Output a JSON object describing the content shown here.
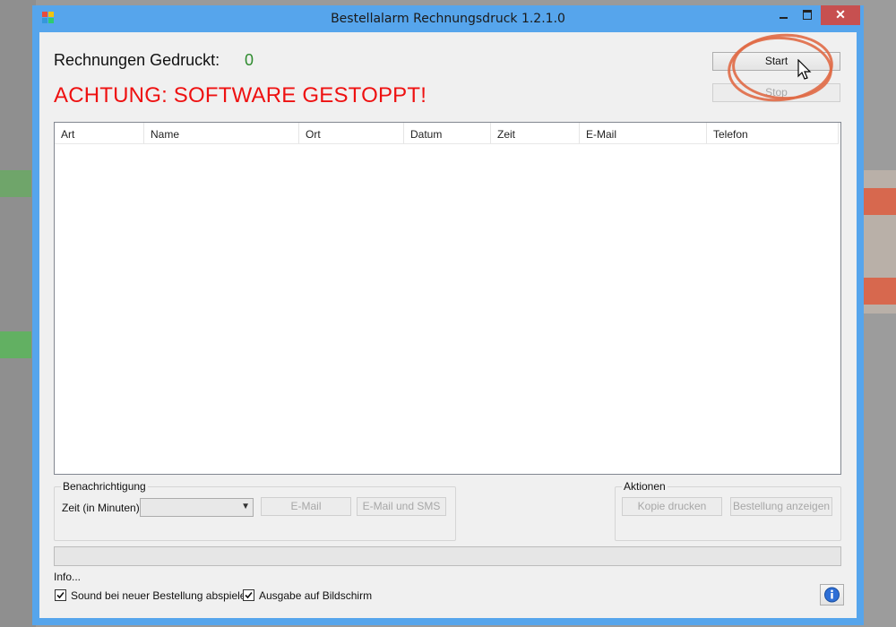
{
  "window": {
    "title": "Bestellalarm Rechnungsdruck 1.2.1.0",
    "close_glyph": "✕"
  },
  "status": {
    "count_label": "Rechnungen Gedruckt:",
    "count_value": "0",
    "warning": "ACHTUNG: SOFTWARE GESTOPPT!"
  },
  "controls": {
    "start_label": "Start",
    "stop_label": "Stop"
  },
  "table": {
    "columns": [
      "Art",
      "Name",
      "Ort",
      "Datum",
      "Zeit",
      "E-Mail",
      "Telefon"
    ],
    "rows": []
  },
  "notification": {
    "group_title": "Benachrichtigung",
    "time_label": "Zeit (in Minuten)",
    "time_value": "",
    "email_button": "E-Mail",
    "email_sms_button": "E-Mail und SMS"
  },
  "actions": {
    "group_title": "Aktionen",
    "copy_button": "Kopie drucken",
    "show_order_button": "Bestellung anzeigen"
  },
  "footer": {
    "info_text": "Info...",
    "sound_checkbox": "Sound bei neuer Bestellung abspielen",
    "screen_checkbox": "Ausgabe auf Bildschirm",
    "sound_checked": true,
    "screen_checked": true
  },
  "colors": {
    "window_frame": "#56a5ec",
    "count_value": "#2e8b2e",
    "warning": "#ee1111",
    "annotation_circle": "#e06a46",
    "close_button": "#c75050"
  },
  "icons": {
    "app": "app-icon",
    "minimize": "minimize-icon",
    "maximize": "maximize-icon",
    "close": "close-icon",
    "cursor": "mouse-cursor-icon",
    "info": "info-icon"
  }
}
